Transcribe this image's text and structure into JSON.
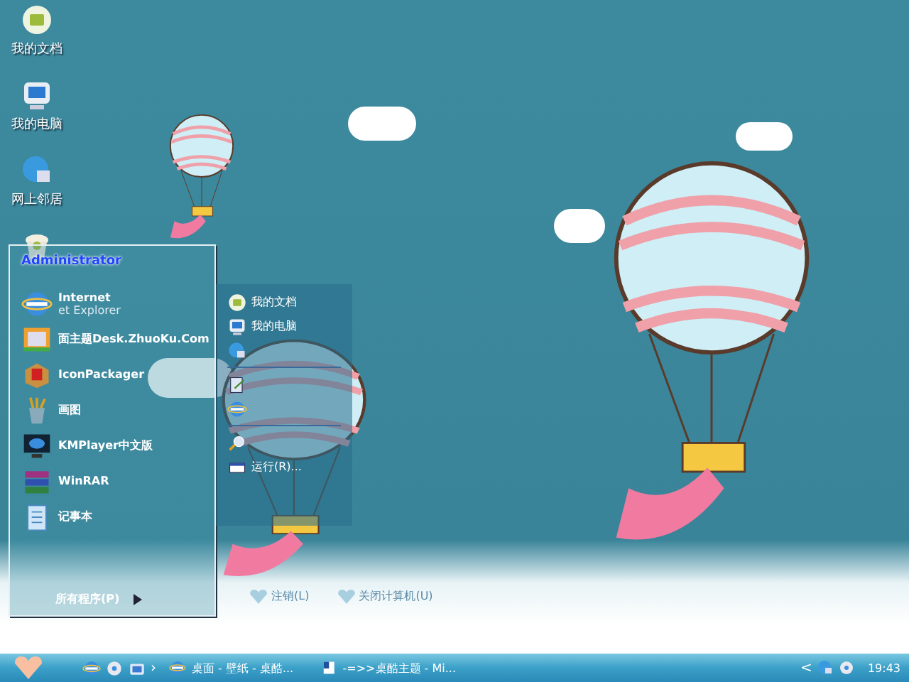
{
  "desktop_icons": [
    {
      "kind": "docs",
      "label": "我的文档"
    },
    {
      "kind": "computer",
      "label": "我的电脑"
    },
    {
      "kind": "network",
      "label": "网上邻居"
    },
    {
      "kind": "recycle"
    }
  ],
  "start_menu": {
    "user": "Administrator",
    "programs": [
      {
        "kind": "ie",
        "title": "Internet",
        "subtitle": "et Explorer"
      },
      {
        "kind": "theme",
        "title": "面主题Desk.ZhuoKu.Com"
      },
      {
        "kind": "box",
        "title": "IconPackager"
      },
      {
        "kind": "paint",
        "title": "画图"
      },
      {
        "kind": "player",
        "title": "KMPlayer中文版"
      },
      {
        "kind": "rar",
        "title": "WinRAR"
      },
      {
        "kind": "notepad",
        "title": "记事本"
      }
    ],
    "all_programs": "所有程序(P)",
    "places": [
      {
        "kind": "docs",
        "label": "我的文档"
      },
      {
        "kind": "computer",
        "label": "我的电脑"
      },
      {
        "kind": "network"
      },
      {
        "kind": "sep"
      },
      {
        "kind": "control"
      },
      {
        "kind": "globe"
      },
      {
        "kind": "sep"
      },
      {
        "kind": "search"
      },
      {
        "kind": "run",
        "label": "运行(R)..."
      }
    ],
    "logoff": "注销(L)",
    "shutdown": "关闭计算机(U)"
  },
  "taskbar": {
    "quick_launch": [
      {
        "kind": "ie"
      },
      {
        "kind": "media"
      },
      {
        "kind": "folder"
      }
    ],
    "chevron": "›",
    "tasks": [
      {
        "kind": "ie",
        "label": "桌面 - 壁纸 - 桌酷..."
      },
      {
        "kind": "word",
        "label": "-=>>桌酷主题 - Mi..."
      }
    ],
    "tray_chevron": "<",
    "clock": "19:43"
  }
}
